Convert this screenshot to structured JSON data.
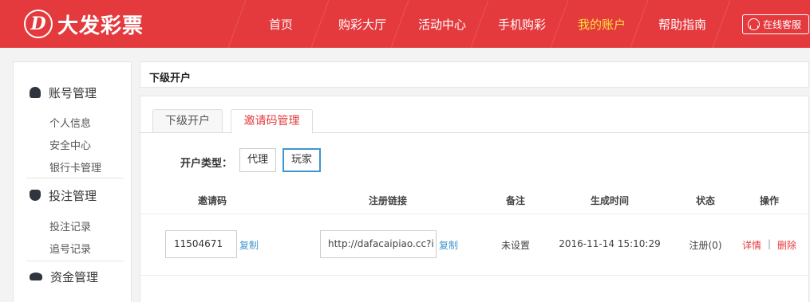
{
  "header": {
    "logo_mark": "D",
    "logo_text": "大发彩票",
    "nav": [
      "首页",
      "购彩大厅",
      "活动中心",
      "手机购彩",
      "我的账户",
      "帮助指南"
    ],
    "active_nav": "我的账户",
    "service_label": "在线客服",
    "accent_color": "#e43a3e",
    "active_color": "#ffe03c"
  },
  "sidebar": {
    "groups": [
      {
        "title": "账号管理",
        "icon": "user-icon",
        "links": [
          "个人信息",
          "安全中心",
          "银行卡管理"
        ]
      },
      {
        "title": "投注管理",
        "icon": "bag-icon",
        "links": [
          "投注记录",
          "追号记录"
        ]
      },
      {
        "title": "资金管理",
        "icon": "money-icon",
        "links": []
      }
    ]
  },
  "main": {
    "title": "下级开户",
    "tabs": [
      "下级开户",
      "邀请码管理"
    ],
    "active_tab": "邀请码管理",
    "type_label": "开户类型：",
    "type_options": [
      "代理",
      "玩家"
    ],
    "selected_type": "玩家",
    "columns": [
      "邀请码",
      "注册链接",
      "备注",
      "生成时间",
      "状态",
      "操作"
    ],
    "row": {
      "code": "11504671",
      "copy_label": "复制",
      "link": "http://dafacaipiao.cc?i",
      "note": "未设置",
      "time": "2016-11-14 15:10:29",
      "status": "注册(0)",
      "action_detail": "详情",
      "action_sep": "|",
      "action_delete": "删除"
    },
    "link_color": "#3d96d1"
  }
}
